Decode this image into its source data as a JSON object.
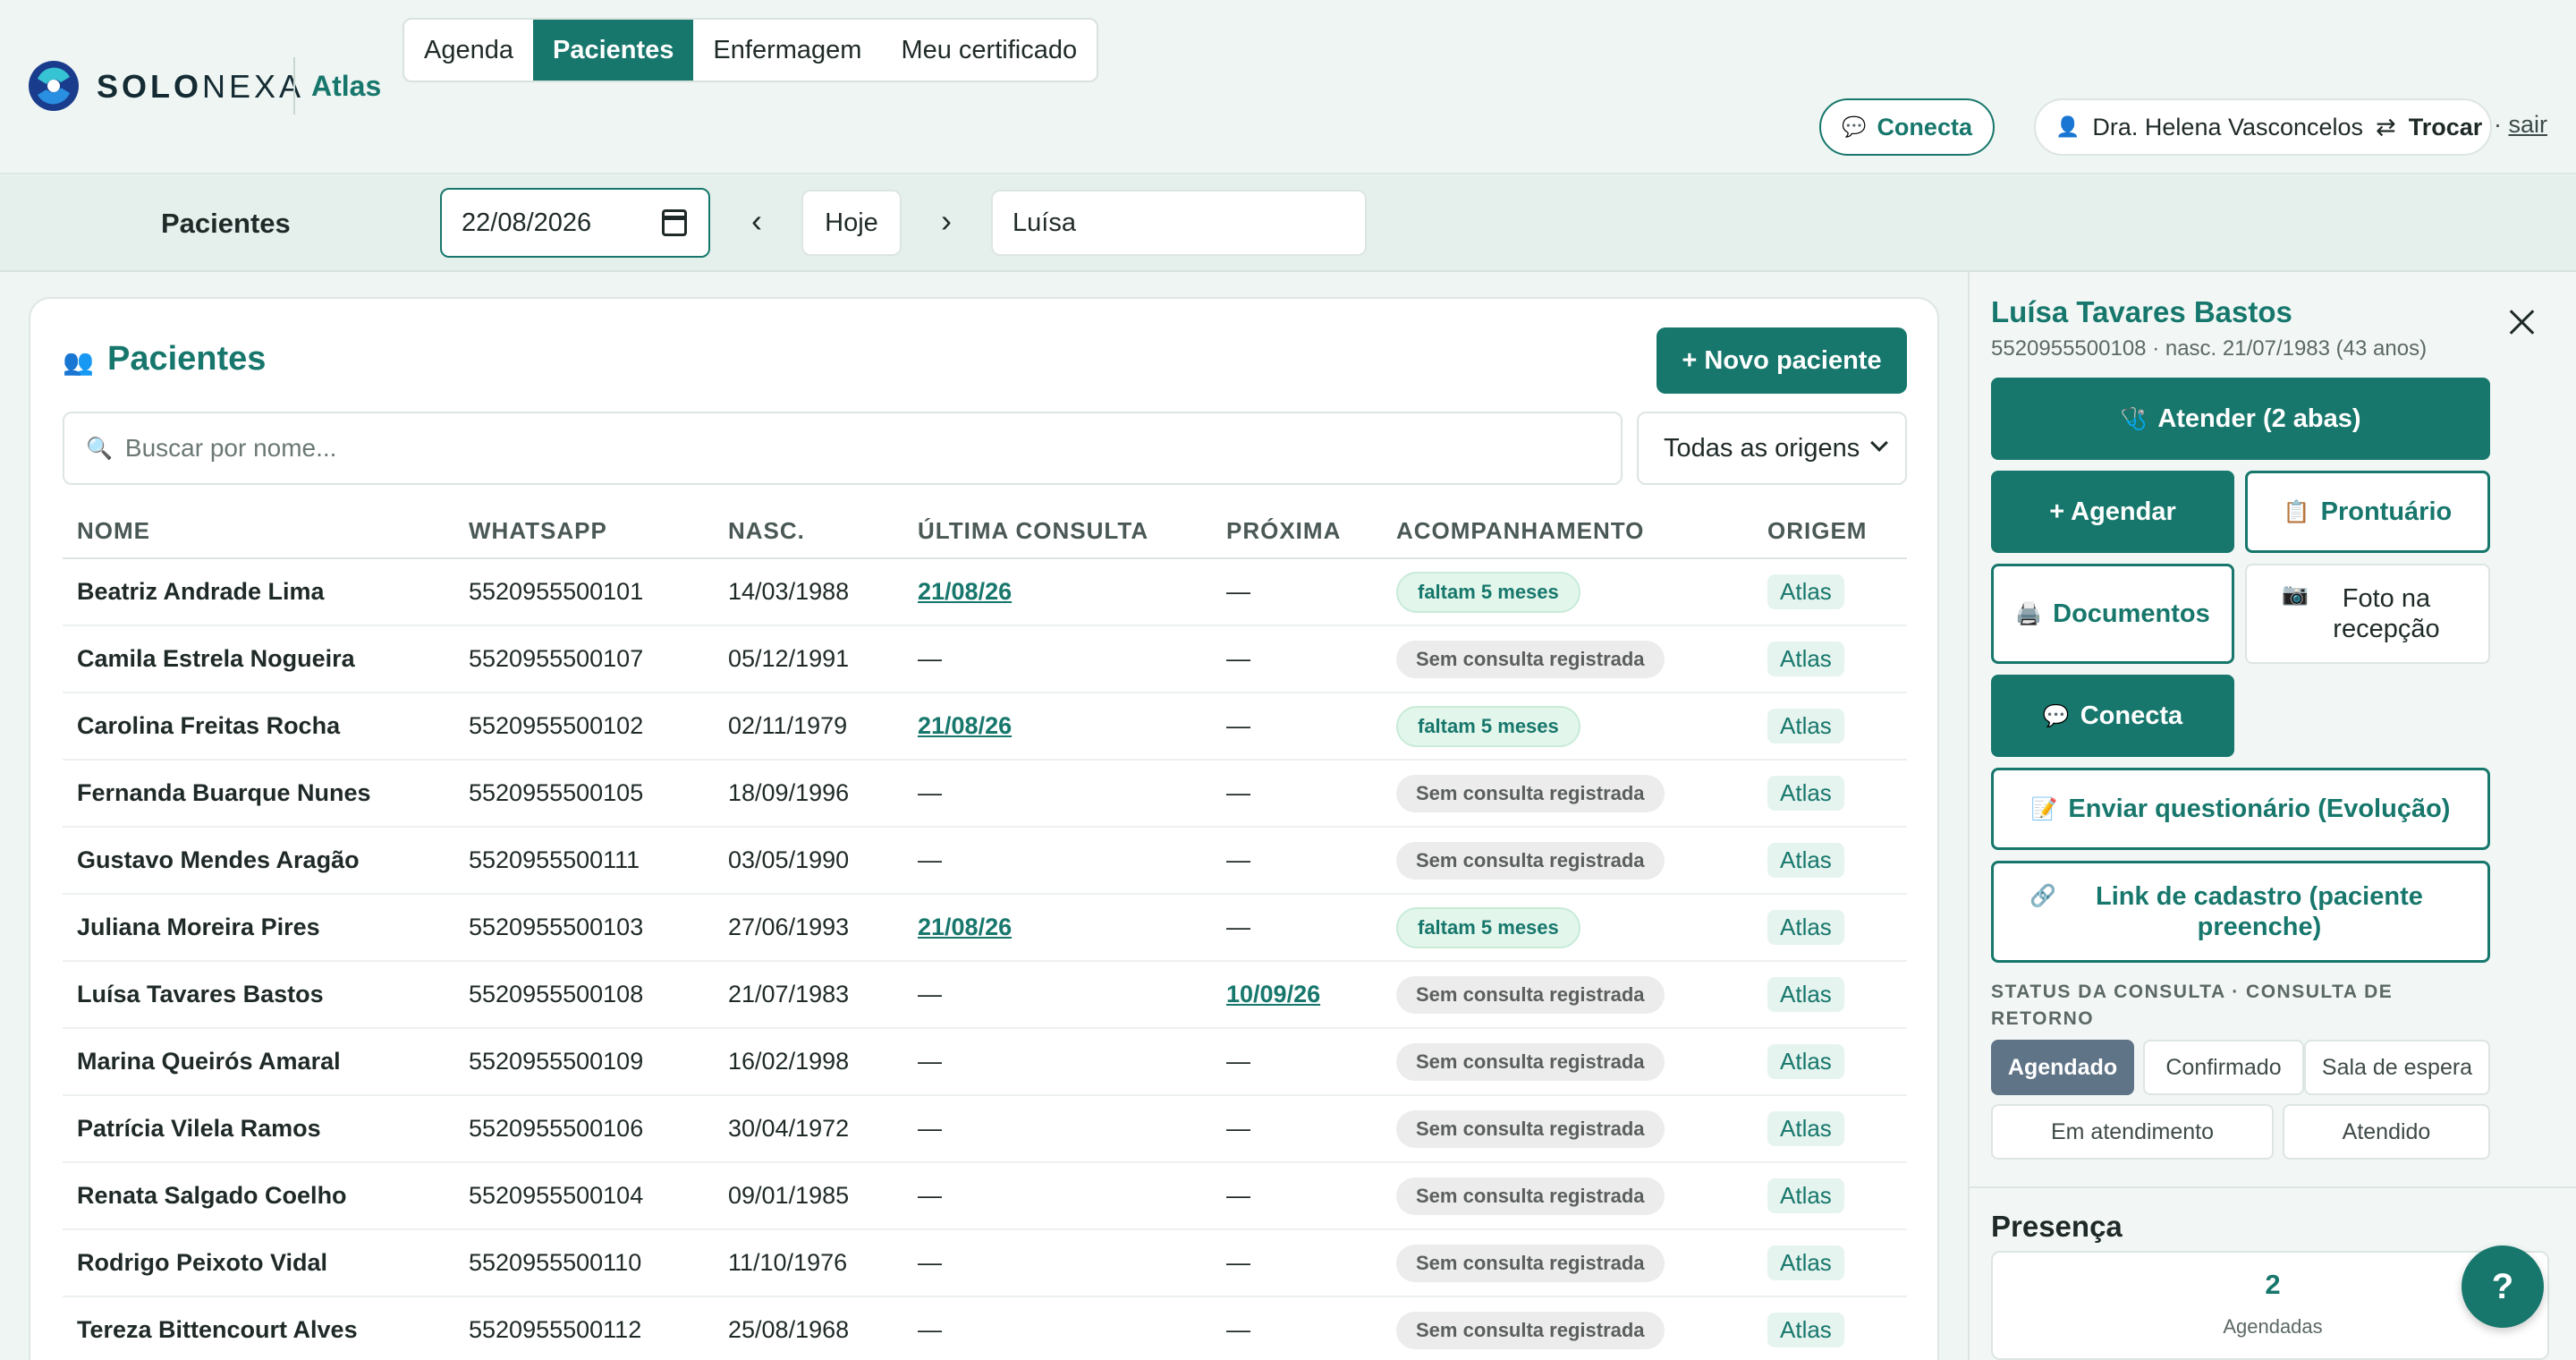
{
  "brand": {
    "name_bold": "SOLO",
    "name_thin": "NEXA",
    "app": "Atlas"
  },
  "nav": {
    "tabs": [
      "Agenda",
      "Pacientes",
      "Enfermagem",
      "Meu certificado"
    ],
    "active": "Pacientes"
  },
  "header": {
    "conecta_label": "Conecta",
    "user_name": "Dra. Helena Vasconcelos",
    "switch_label": "Trocar",
    "logout_label": "sair"
  },
  "filter": {
    "title": "Pacientes",
    "date": "22/08/2026",
    "prev": "‹",
    "today_label": "Hoje",
    "next": "›",
    "name_value": "Luísa"
  },
  "card": {
    "title": "Pacientes",
    "new_button": "+ Novo paciente",
    "search_placeholder": "Buscar por nome...",
    "origin_select": "Todas as origens"
  },
  "table": {
    "headers": [
      "NOME",
      "WHATSAPP",
      "NASC.",
      "ÚLTIMA CONSULTA",
      "PRÓXIMA",
      "ACOMPANHAMENTO",
      "ORIGEM"
    ],
    "rows": [
      {
        "name": "Beatriz Andrade Lima",
        "whatsapp": "5520955500101",
        "birth": "14/03/1988",
        "last": "21/08/26",
        "next": "—",
        "follow": "faltam 5 meses",
        "origin": "Atlas"
      },
      {
        "name": "Camila Estrela Nogueira",
        "whatsapp": "5520955500107",
        "birth": "05/12/1991",
        "last": "—",
        "next": "—",
        "follow": "Sem consulta registrada",
        "origin": "Atlas"
      },
      {
        "name": "Carolina Freitas Rocha",
        "whatsapp": "5520955500102",
        "birth": "02/11/1979",
        "last": "21/08/26",
        "next": "—",
        "follow": "faltam 5 meses",
        "origin": "Atlas"
      },
      {
        "name": "Fernanda Buarque Nunes",
        "whatsapp": "5520955500105",
        "birth": "18/09/1996",
        "last": "—",
        "next": "—",
        "follow": "Sem consulta registrada",
        "origin": "Atlas"
      },
      {
        "name": "Gustavo Mendes Aragão",
        "whatsapp": "5520955500111",
        "birth": "03/05/1990",
        "last": "—",
        "next": "—",
        "follow": "Sem consulta registrada",
        "origin": "Atlas"
      },
      {
        "name": "Juliana Moreira Pires",
        "whatsapp": "5520955500103",
        "birth": "27/06/1993",
        "last": "21/08/26",
        "next": "—",
        "follow": "faltam 5 meses",
        "origin": "Atlas"
      },
      {
        "name": "Luísa Tavares Bastos",
        "whatsapp": "5520955500108",
        "birth": "21/07/1983",
        "last": "—",
        "next": "10/09/26",
        "follow": "Sem consulta registrada",
        "origin": "Atlas"
      },
      {
        "name": "Marina Queirós Amaral",
        "whatsapp": "5520955500109",
        "birth": "16/02/1998",
        "last": "—",
        "next": "—",
        "follow": "Sem consulta registrada",
        "origin": "Atlas"
      },
      {
        "name": "Patrícia Vilela Ramos",
        "whatsapp": "5520955500106",
        "birth": "30/04/1972",
        "last": "—",
        "next": "—",
        "follow": "Sem consulta registrada",
        "origin": "Atlas"
      },
      {
        "name": "Renata Salgado Coelho",
        "whatsapp": "5520955500104",
        "birth": "09/01/1985",
        "last": "—",
        "next": "—",
        "follow": "Sem consulta registrada",
        "origin": "Atlas"
      },
      {
        "name": "Rodrigo Peixoto Vidal",
        "whatsapp": "5520955500110",
        "birth": "11/10/1976",
        "last": "—",
        "next": "—",
        "follow": "Sem consulta registrada",
        "origin": "Atlas"
      },
      {
        "name": "Tereza Bittencourt Alves",
        "whatsapp": "5520955500112",
        "birth": "25/08/1968",
        "last": "—",
        "next": "—",
        "follow": "Sem consulta registrada",
        "origin": "Atlas"
      }
    ]
  },
  "side": {
    "name": "Luísa Tavares Bastos",
    "meta": "5520955500108 · nasc. 21/07/1983 (43 anos)",
    "attend": "Atender (2 abas)",
    "schedule": "+ Agendar",
    "record": "Prontuário",
    "documents": "Documentos",
    "photo": "Foto na recepção",
    "conecta": "Conecta",
    "questionnaire": "Enviar questionário (Evolução)",
    "signup_link": "Link de cadastro (paciente preenche)",
    "status_label": "STATUS DA CONSULTA · CONSULTA DE RETORNO",
    "statuses": [
      "Agendado",
      "Confirmado",
      "Sala de espera",
      "Em atendimento",
      "Atendido"
    ],
    "active_status": "Agendado",
    "presence_title": "Presença",
    "presence_count": "2",
    "presence_label": "Agendadas",
    "help": "?"
  },
  "icons": {
    "patients": "people-icon",
    "search": "magnifier-icon",
    "conecta": "chat-bubble-icon",
    "user": "user-icon",
    "switch": "swap-arrows-icon",
    "attend": "stethoscope-icon",
    "record": "clipboard-icon",
    "documents": "printer-icon",
    "photo": "camera-icon",
    "questionnaire": "memo-icon",
    "link": "link-icon"
  },
  "colors": {
    "accent": "#17776c",
    "status_active": "#5f7486",
    "badge_ok_bg": "#e3f6ec",
    "badge_none_bg": "#ececec"
  }
}
